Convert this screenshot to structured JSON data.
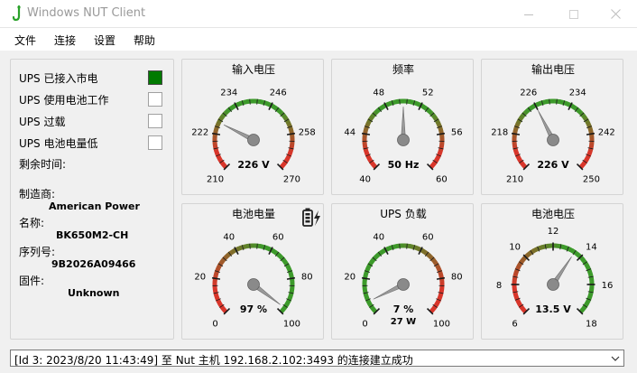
{
  "window": {
    "title": "Windows NUT Client",
    "icon": "nut-app-icon",
    "controls": [
      "minimize-icon",
      "maximize-icon",
      "close-icon"
    ]
  },
  "menu": {
    "file": "文件",
    "connect": "连接",
    "settings": "设置",
    "help": "帮助"
  },
  "status": [
    {
      "label": "UPS 已接入市电",
      "on": true
    },
    {
      "label": "UPS 使用电池工作",
      "on": false
    },
    {
      "label": "UPS 过载",
      "on": false
    },
    {
      "label": "UPS 电池电量低",
      "on": false
    }
  ],
  "runtime_label": "剩余时间:",
  "info": {
    "manufacturer_label": "制造商:",
    "manufacturer": "American Power",
    "model_label": "名称:",
    "model": "BK650M2-CH",
    "serial_label": "序列号:",
    "serial": "9B2026A09466",
    "firmware_label": "固件:",
    "firmware": "Unknown"
  },
  "gauges": [
    {
      "title": "输入电压",
      "min": 210,
      "max": 270,
      "labels": [
        "210",
        "222",
        "234",
        "246",
        "258",
        "270"
      ],
      "value": 226,
      "readout": "226 V",
      "readout2": "",
      "colors": "red-green-red",
      "battery_icon": false
    },
    {
      "title": "频率",
      "min": 40,
      "max": 60,
      "labels": [
        "40",
        "44",
        "48",
        "52",
        "56",
        "60"
      ],
      "value": 50,
      "readout": "50 Hz",
      "readout2": "",
      "colors": "red-green-red",
      "battery_icon": false
    },
    {
      "title": "输出电压",
      "min": 210,
      "max": 250,
      "labels": [
        "210",
        "218",
        "226",
        "234",
        "242",
        "250"
      ],
      "value": 226,
      "readout": "226 V",
      "readout2": "",
      "colors": "red-green-red",
      "battery_icon": false
    },
    {
      "title": "电池电量",
      "min": 0,
      "max": 100,
      "labels": [
        "0",
        "20",
        "40",
        "60",
        "80",
        "100"
      ],
      "value": 97,
      "readout": "97 %",
      "readout2": "",
      "colors": "red-green",
      "battery_icon": true
    },
    {
      "title": "UPS 负载",
      "min": 0,
      "max": 100,
      "labels": [
        "0",
        "20",
        "40",
        "60",
        "80",
        "100"
      ],
      "value": 7,
      "readout": "7 %",
      "readout2": "27 W",
      "colors": "green-red",
      "battery_icon": false
    },
    {
      "title": "电池电压",
      "min": 6,
      "max": 18,
      "labels": [
        "6",
        "8",
        "10",
        "12",
        "14",
        "16",
        "18"
      ],
      "value": 13.5,
      "readout": "13.5 V",
      "readout2": "",
      "colors": "red-green",
      "battery_icon": false
    }
  ],
  "log": {
    "text": "[Id 3: 2023/8/20 11:43:49] 至 Nut 主机 192.168.2.102:3493 的连接建立成功"
  },
  "colors": {
    "green": "#007a00",
    "zone_green": "#3c9a2a",
    "zone_red": "#d8352a",
    "needle": "#9a9a9a"
  }
}
